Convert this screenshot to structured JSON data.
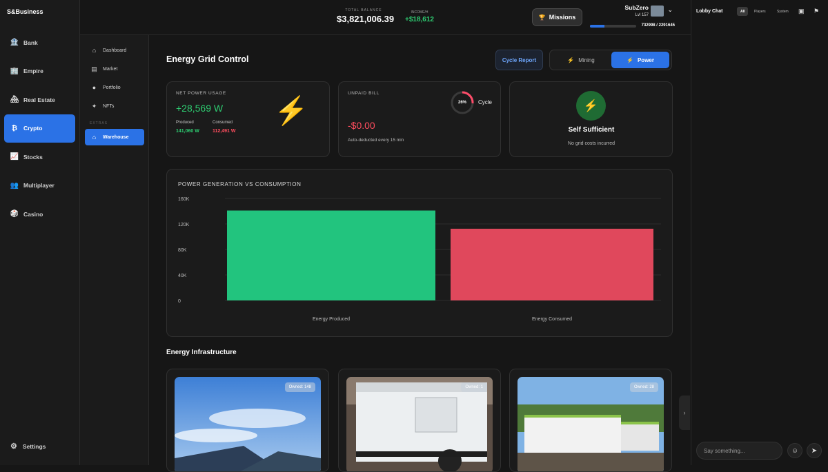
{
  "app": {
    "brand": "S&Business"
  },
  "sidebar": {
    "items": [
      {
        "label": "Bank",
        "icon": "bank-icon",
        "glyph": "🏦"
      },
      {
        "label": "Empire",
        "icon": "building-icon",
        "glyph": "🏢"
      },
      {
        "label": "Real Estate",
        "icon": "house-icon",
        "glyph": "🏘"
      },
      {
        "label": "Crypto",
        "icon": "bitcoin-icon",
        "glyph": "₿"
      },
      {
        "label": "Stocks",
        "icon": "trend-icon",
        "glyph": "📈"
      },
      {
        "label": "Multiplayer",
        "icon": "users-icon",
        "glyph": "👥"
      },
      {
        "label": "Casino",
        "icon": "dice-icon",
        "glyph": "🎲"
      }
    ],
    "settings": "Settings",
    "collapse": "‹"
  },
  "subnav": {
    "items": [
      {
        "label": "Dashboard",
        "icon": "home-icon",
        "glyph": "⌂"
      },
      {
        "label": "Market",
        "icon": "store-icon",
        "glyph": "▤"
      },
      {
        "label": "Portfolio",
        "icon": "person-icon",
        "glyph": "●"
      },
      {
        "label": "NFTs",
        "icon": "sparkle-icon",
        "glyph": "✦"
      }
    ],
    "section": "EXTRAS",
    "extra": {
      "label": "Warehouse",
      "icon": "warehouse-icon",
      "glyph": "⌂"
    }
  },
  "topbar": {
    "balance_label": "TOTAL BALANCE",
    "balance": "$3,821,006.39",
    "income_label": "INCOME/H",
    "income": "+$18,612",
    "missions": "Missions",
    "username": "SubZero",
    "level": "Lvl 157",
    "xp_text": "732998 / 2291645",
    "xp_fraction": 0.32
  },
  "main": {
    "title": "Energy Grid Control",
    "cycle_report": "Cycle Report",
    "toggle": {
      "mining": "Mining",
      "power": "Power"
    },
    "net": {
      "label": "NET POWER USAGE",
      "value": "+28,569 W",
      "produced_label": "Produced",
      "produced": "141,060 W",
      "consumed_label": "Consumed",
      "consumed": "112,491 W"
    },
    "bill": {
      "label": "UNPAID BILL",
      "value": "-$0.00",
      "note": "Auto-deducted every 15 min",
      "cycle_percent": "26%",
      "cycle_fraction": 0.26,
      "cycle_label": "Cycle"
    },
    "status": {
      "title": "Self Sufficient",
      "note": "No grid costs incurred"
    },
    "infra_title": "Energy Infrastructure",
    "assets": [
      {
        "owned": "Owned: 148"
      },
      {
        "owned": "Owned: 1"
      },
      {
        "owned": "Owned: 28"
      }
    ]
  },
  "chart_data": {
    "type": "bar",
    "title": "POWER GENERATION VS CONSUMPTION",
    "categories": [
      "Energy Produced",
      "Energy Consumed"
    ],
    "values": [
      141060,
      112491
    ],
    "colors": [
      "#22c47e",
      "#e0485c"
    ],
    "ylim": [
      0,
      160000
    ],
    "yticks": [
      0,
      40000,
      80000,
      120000,
      160000
    ],
    "ytick_labels": [
      "0",
      "40K",
      "80K",
      "120K",
      "160K"
    ],
    "grid": true
  },
  "chat": {
    "title": "Lobby Chat",
    "tabs": [
      "All",
      "Players",
      "System"
    ],
    "placeholder": "Say something...",
    "collapse": "›"
  }
}
